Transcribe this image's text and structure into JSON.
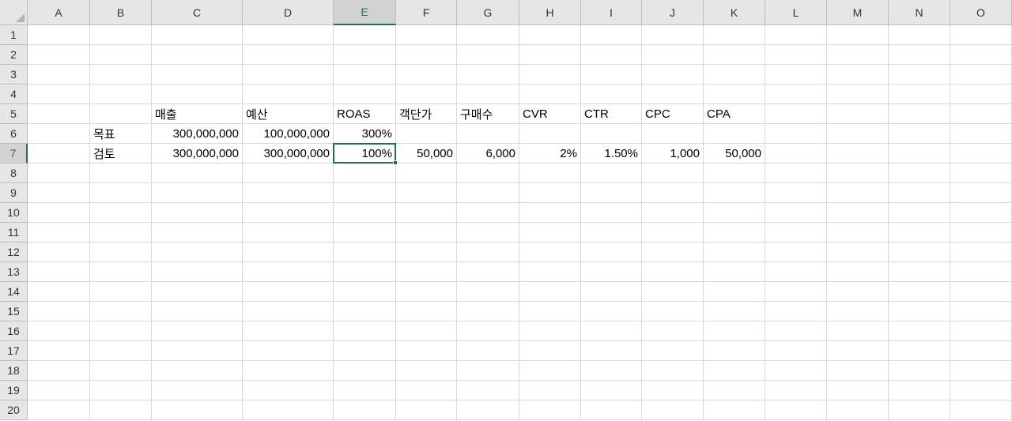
{
  "columns": [
    "A",
    "B",
    "C",
    "D",
    "E",
    "F",
    "G",
    "H",
    "I",
    "J",
    "K",
    "L",
    "M",
    "N",
    "O"
  ],
  "rows": [
    "1",
    "2",
    "3",
    "4",
    "5",
    "6",
    "7",
    "8",
    "9",
    "10",
    "11",
    "12",
    "13",
    "14",
    "15",
    "16",
    "17",
    "18",
    "19",
    "20"
  ],
  "selected_cell": "E7",
  "accent_color": "#217346",
  "cells": {
    "C5": "매출",
    "D5": "예산",
    "E5": "ROAS",
    "F5": "객단가",
    "G5": "구매수",
    "H5": "CVR",
    "I5": "CTR",
    "J5": "CPC",
    "K5": "CPA",
    "B6": "목표",
    "C6": "300,000,000",
    "D6": "100,000,000",
    "E6": "300%",
    "B7": "검토",
    "C7": "300,000,000",
    "D7": "300,000,000",
    "E7": "100%",
    "F7": "50,000",
    "G7": "6,000",
    "H7": "2%",
    "I7": "1.50%",
    "J7": "1,000",
    "K7": "50,000"
  }
}
